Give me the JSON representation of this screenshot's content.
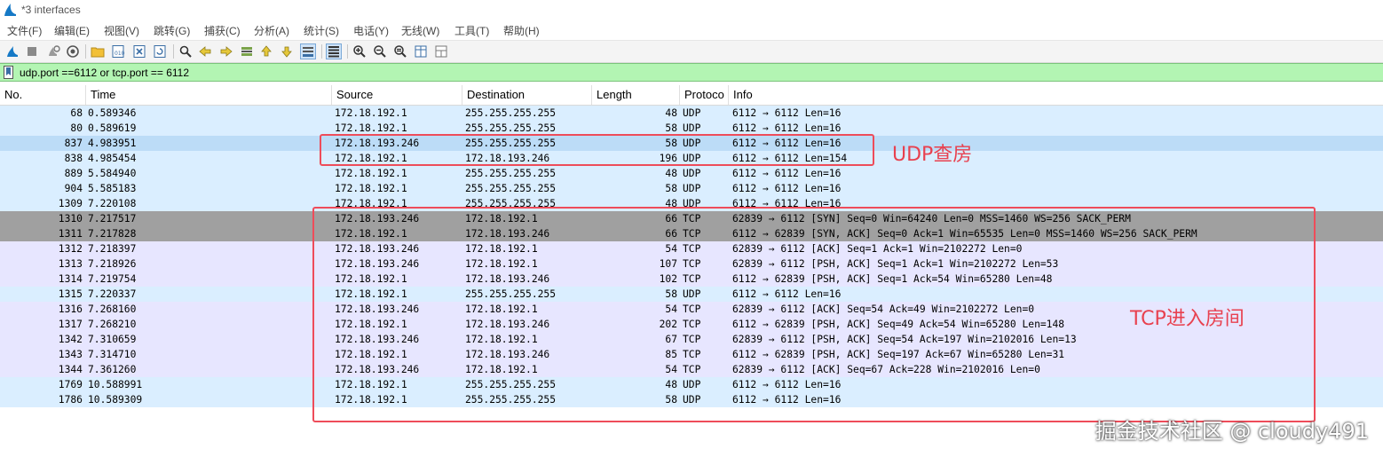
{
  "window": {
    "title": "*3 interfaces"
  },
  "menu": [
    "文件(F)",
    "编辑(E)",
    "视图(V)",
    "跳转(G)",
    "捕获(C)",
    "分析(A)",
    "统计(S)",
    "电话(Y)",
    "无线(W)",
    "工具(T)",
    "帮助(H)"
  ],
  "toolbar": {
    "buttons": [
      "start-capture-icon",
      "stop-capture-icon",
      "restart-capture-icon",
      "capture-options-icon",
      "open-file-icon",
      "save-file-icon",
      "close-file-icon",
      "reload-file-icon",
      "find-packet-icon",
      "go-back-icon",
      "go-forward-icon",
      "go-to-packet-icon",
      "go-first-icon",
      "go-last-icon",
      "auto-scroll-icon",
      "colorize-icon",
      "zoom-in-icon",
      "zoom-out-icon",
      "zoom-normal-icon",
      "resize-columns-icon",
      "layout-icon"
    ]
  },
  "filter": {
    "text": "udp.port ==6112 or tcp.port == 6112"
  },
  "columns": [
    "No.",
    "Time",
    "Source",
    "Destination",
    "Length",
    "Protoco",
    "Info"
  ],
  "colors": {
    "udp_row": "#daeeff",
    "udp_selected": "#bcdcf7",
    "tcp_row": "#e7e6ff",
    "tcp_syn": "#a0a0a0",
    "filter_ok": "#b3f5b3",
    "annotation": "#ee4c5a"
  },
  "packets": [
    {
      "no": "68",
      "time": "0.589346",
      "src": "172.18.192.1",
      "dst": "255.255.255.255",
      "len": "48",
      "proto": "UDP",
      "info": "6112 → 6112 Len=16",
      "style": "udp"
    },
    {
      "no": "80",
      "time": "0.589619",
      "src": "172.18.192.1",
      "dst": "255.255.255.255",
      "len": "58",
      "proto": "UDP",
      "info": "6112 → 6112 Len=16",
      "style": "udp"
    },
    {
      "no": "837",
      "time": "4.983951",
      "src": "172.18.193.246",
      "dst": "255.255.255.255",
      "len": "58",
      "proto": "UDP",
      "info": "6112 → 6112 Len=16",
      "style": "udp-sel"
    },
    {
      "no": "838",
      "time": "4.985454",
      "src": "172.18.192.1",
      "dst": "172.18.193.246",
      "len": "196",
      "proto": "UDP",
      "info": "6112 → 6112 Len=154",
      "style": "udp"
    },
    {
      "no": "889",
      "time": "5.584940",
      "src": "172.18.192.1",
      "dst": "255.255.255.255",
      "len": "48",
      "proto": "UDP",
      "info": "6112 → 6112 Len=16",
      "style": "udp"
    },
    {
      "no": "904",
      "time": "5.585183",
      "src": "172.18.192.1",
      "dst": "255.255.255.255",
      "len": "58",
      "proto": "UDP",
      "info": "6112 → 6112 Len=16",
      "style": "udp"
    },
    {
      "no": "1309",
      "time": "7.220108",
      "src": "172.18.192.1",
      "dst": "255.255.255.255",
      "len": "48",
      "proto": "UDP",
      "info": "6112 → 6112 Len=16",
      "style": "udp"
    },
    {
      "no": "1310",
      "time": "7.217517",
      "src": "172.18.193.246",
      "dst": "172.18.192.1",
      "len": "66",
      "proto": "TCP",
      "info": "62839 → 6112 [SYN] Seq=0 Win=64240 Len=0 MSS=1460 WS=256 SACK_PERM",
      "style": "syn"
    },
    {
      "no": "1311",
      "time": "7.217828",
      "src": "172.18.192.1",
      "dst": "172.18.193.246",
      "len": "66",
      "proto": "TCP",
      "info": "6112 → 62839 [SYN, ACK] Seq=0 Ack=1 Win=65535 Len=0 MSS=1460 WS=256 SACK_PERM",
      "style": "syn"
    },
    {
      "no": "1312",
      "time": "7.218397",
      "src": "172.18.193.246",
      "dst": "172.18.192.1",
      "len": "54",
      "proto": "TCP",
      "info": "62839 → 6112 [ACK] Seq=1 Ack=1 Win=2102272 Len=0",
      "style": "tcp"
    },
    {
      "no": "1313",
      "time": "7.218926",
      "src": "172.18.193.246",
      "dst": "172.18.192.1",
      "len": "107",
      "proto": "TCP",
      "info": "62839 → 6112 [PSH, ACK] Seq=1 Ack=1 Win=2102272 Len=53",
      "style": "tcp"
    },
    {
      "no": "1314",
      "time": "7.219754",
      "src": "172.18.192.1",
      "dst": "172.18.193.246",
      "len": "102",
      "proto": "TCP",
      "info": "6112 → 62839 [PSH, ACK] Seq=1 Ack=54 Win=65280 Len=48",
      "style": "tcp"
    },
    {
      "no": "1315",
      "time": "7.220337",
      "src": "172.18.192.1",
      "dst": "255.255.255.255",
      "len": "58",
      "proto": "UDP",
      "info": "6112 → 6112 Len=16",
      "style": "udp"
    },
    {
      "no": "1316",
      "time": "7.268160",
      "src": "172.18.193.246",
      "dst": "172.18.192.1",
      "len": "54",
      "proto": "TCP",
      "info": "62839 → 6112 [ACK] Seq=54 Ack=49 Win=2102272 Len=0",
      "style": "tcp"
    },
    {
      "no": "1317",
      "time": "7.268210",
      "src": "172.18.192.1",
      "dst": "172.18.193.246",
      "len": "202",
      "proto": "TCP",
      "info": "6112 → 62839 [PSH, ACK] Seq=49 Ack=54 Win=65280 Len=148",
      "style": "tcp"
    },
    {
      "no": "1342",
      "time": "7.310659",
      "src": "172.18.193.246",
      "dst": "172.18.192.1",
      "len": "67",
      "proto": "TCP",
      "info": "62839 → 6112 [PSH, ACK] Seq=54 Ack=197 Win=2102016 Len=13",
      "style": "tcp"
    },
    {
      "no": "1343",
      "time": "7.314710",
      "src": "172.18.192.1",
      "dst": "172.18.193.246",
      "len": "85",
      "proto": "TCP",
      "info": "6112 → 62839 [PSH, ACK] Seq=197 Ack=67 Win=65280 Len=31",
      "style": "tcp"
    },
    {
      "no": "1344",
      "time": "7.361260",
      "src": "172.18.193.246",
      "dst": "172.18.192.1",
      "len": "54",
      "proto": "TCP",
      "info": "62839 → 6112 [ACK] Seq=67 Ack=228 Win=2102016 Len=0",
      "style": "tcp"
    },
    {
      "no": "1769",
      "time": "10.588991",
      "src": "172.18.192.1",
      "dst": "255.255.255.255",
      "len": "48",
      "proto": "UDP",
      "info": "6112 → 6112 Len=16",
      "style": "udp"
    },
    {
      "no": "1786",
      "time": "10.589309",
      "src": "172.18.192.1",
      "dst": "255.255.255.255",
      "len": "58",
      "proto": "UDP",
      "info": "6112 → 6112 Len=16",
      "style": "udp"
    }
  ],
  "annotations": {
    "udp_label": "UDP查房",
    "tcp_label": "TCP进入房间"
  },
  "watermark": "掘金技术社区 @ cloudy491"
}
